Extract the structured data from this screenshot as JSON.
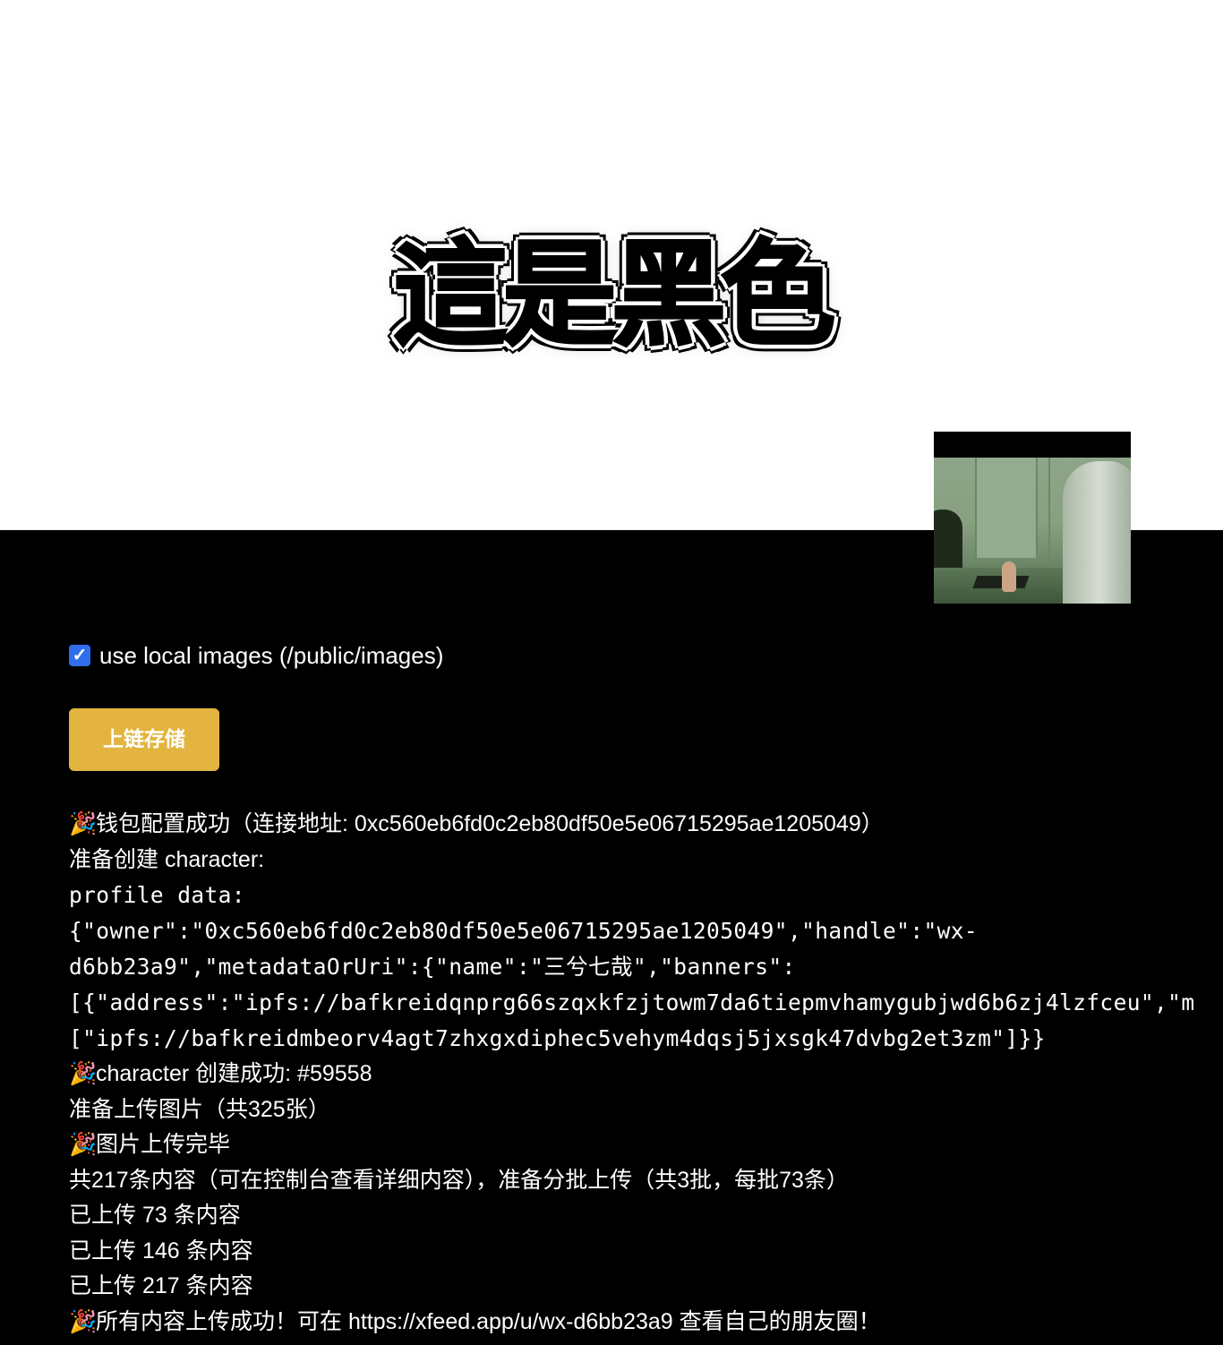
{
  "banner": {
    "headline": "這是黑色"
  },
  "controls": {
    "use_local_images_label": "use local images (/public/images)",
    "use_local_images_checked": true,
    "upload_button_label": "上链存储",
    "upload_button_color": "#e3b43f",
    "checkbox_color": "#2f6fed"
  },
  "log": {
    "party_icon": "🎉",
    "wallet_success": "钱包配置成功（连接地址: 0xc560eb6fd0c2eb80df50e5e06715295ae1205049）",
    "prepare_character": "准备创建 character:",
    "profile_label": "profile data:",
    "profile_json_line1": "{\"owner\":\"0xc560eb6fd0c2eb80df50e5e06715295ae1205049\",\"handle\":\"wx-",
    "profile_json_line2": "d6bb23a9\",\"metadataOrUri\":{\"name\":\"三兮七哉\",\"banners\":",
    "profile_json_line3": "[{\"address\":\"ipfs://bafkreidqnprg66szqxkfzjtowm7da6tiepmvhamygubjwd6b6zj4lzfceu\",\"m",
    "profile_json_line4": "[\"ipfs://bafkreidmbeorv4agt7zhxgxdiphec5vehym4dqsj5jxsgk47dvbg2et3zm\"]}}",
    "character_success": "character 创建成功: #59558",
    "prepare_images": "准备上传图片（共325张）",
    "images_done": "图片上传完毕",
    "batch_info": "共217条内容（可在控制台查看详细内容），准备分批上传（共3批，每批73条）",
    "uploaded_1": "已上传 73 条内容",
    "uploaded_2": "已上传 146 条内容",
    "uploaded_3": "已上传 217 条内容",
    "all_success": "所有内容上传成功！可在 https://xfeed.app/u/wx-d6bb23a9 查看自己的朋友圈！"
  }
}
